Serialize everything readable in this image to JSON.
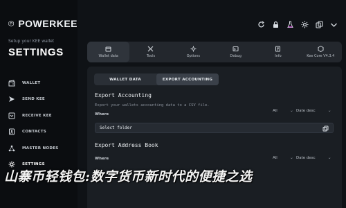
{
  "brand": {
    "name": "POWERKEE"
  },
  "sidebar": {
    "setup_text": "Setup your KEE wallet",
    "heading": "SETTINGS",
    "items": [
      {
        "label": "WALLET",
        "icon": "wallet-icon"
      },
      {
        "label": "SEND KEE",
        "icon": "send-icon"
      },
      {
        "label": "RECEIVE KEE",
        "icon": "receive-icon"
      },
      {
        "label": "CONTACTS",
        "icon": "contacts-icon"
      },
      {
        "label": "MASTER NODES",
        "icon": "nodes-icon"
      },
      {
        "label": "SETTINGS",
        "icon": "gear-icon"
      }
    ]
  },
  "header_icons": [
    "refresh-icon",
    "lock-icon",
    "flask-icon",
    "gear-icon",
    "copy-icon",
    "minimize-icon"
  ],
  "toolbar": {
    "items": [
      {
        "label": "Wallet data",
        "icon": "wallet-data-icon",
        "active": true
      },
      {
        "label": "Tools",
        "icon": "tools-icon"
      },
      {
        "label": "Options",
        "icon": "options-icon"
      },
      {
        "label": "Debug",
        "icon": "debug-icon"
      },
      {
        "label": "Info",
        "icon": "info-icon"
      },
      {
        "label": "Kee Core V4.3.4",
        "icon": "core-icon"
      }
    ]
  },
  "tabs": [
    {
      "label": "WALLET DATA"
    },
    {
      "label": "EXPORT ACCOUNTING",
      "active": true
    }
  ],
  "export_accounting": {
    "title": "Export Accounting",
    "subtitle": "Export your wallets accounting data to a CSV file.",
    "where_label": "Where",
    "filter_all": "All",
    "filter_date": "Date desc",
    "field_value": "Select folder"
  },
  "export_address": {
    "title": "Export Address Book",
    "where_label": "Where",
    "filter_all": "All",
    "filter_date": "Date desc"
  },
  "overlay_text": "山寨币轻钱包:数字货币新时代的便捷之选",
  "colors": {
    "background": "#0f1216",
    "panel": "#1a1e23",
    "toolbar": "#23272d"
  }
}
